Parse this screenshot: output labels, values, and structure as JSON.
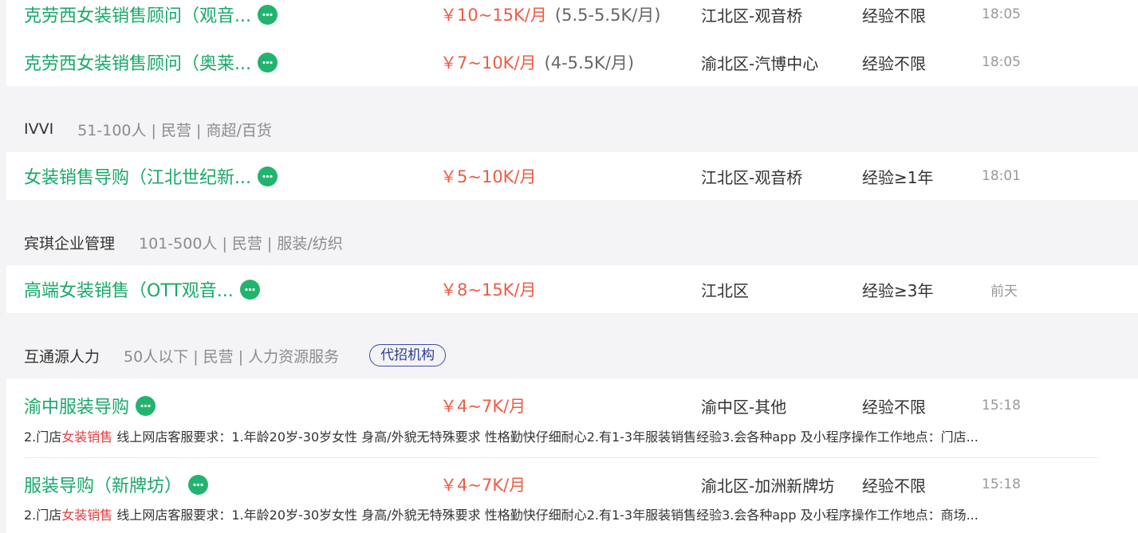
{
  "groups": [
    {
      "jobs": [
        {
          "title": "克劳西女装销售顾问（观音...",
          "salary": "￥10~15K/月",
          "salary_sub": "(5.5-5.5K/月)",
          "area": "江北区-观音桥",
          "exp": "经验不限",
          "time": "18:05"
        },
        {
          "title": "克劳西女装销售顾问（奥莱...",
          "salary": "￥7~10K/月",
          "salary_sub": "(4-5.5K/月)",
          "area": "渝北区-汽博中心",
          "exp": "经验不限",
          "time": "18:05"
        }
      ]
    },
    {
      "company": "IVVI",
      "meta": "51-100人 | 民营 | 商超/百货",
      "jobs": [
        {
          "title": "女装销售导购（江北世纪新...",
          "salary": "￥5~10K/月",
          "area": "江北区-观音桥",
          "exp": "经验≥1年",
          "time": "18:01"
        }
      ]
    },
    {
      "company": "宾琪企业管理",
      "meta": "101-500人 | 民营 | 服装/纺织",
      "jobs": [
        {
          "title": "高端女装销售（OTT观音...",
          "salary": "￥8~15K/月",
          "area": "江北区",
          "exp": "经验≥3年",
          "time": "前天"
        }
      ]
    },
    {
      "company": "互通源人力",
      "meta": "50人以下 | 民营 | 人力资源服务",
      "badge": "代招机构",
      "jobs": [
        {
          "title": "渝中服装导购",
          "salary": "￥4~7K/月",
          "area": "渝中区-其他",
          "exp": "经验不限",
          "time": "15:18",
          "desc_pre": "2.门店",
          "desc_hl": "女装销售",
          "desc_post": " 线上网店客服要求：1.年龄20岁-30岁女性 身高/外貌无特殊要求 性格勤快仔细耐心2.有1-3年服装销售经验3.会各种app 及小程序操作工作地点：门店..."
        },
        {
          "title": "服装导购（新牌坊）",
          "salary": "￥4~7K/月",
          "area": "渝北区-加洲新牌坊",
          "exp": "经验不限",
          "time": "15:18",
          "desc_pre": "2.门店",
          "desc_hl": "女装销售",
          "desc_post": " 线上网店客服要求：1.年龄20岁-30岁女性 身高/外貌无特殊要求 性格勤快仔细耐心2.有1-3年服装销售经验3.会各种app 及小程序操作工作地点：商场..."
        }
      ]
    }
  ],
  "icons": {
    "chat": "chat-bubble-icon"
  },
  "colors": {
    "title": "#17a96a",
    "salary": "#ef5b45",
    "highlight": "#e23d3d",
    "badge": "#3a4bb0"
  }
}
